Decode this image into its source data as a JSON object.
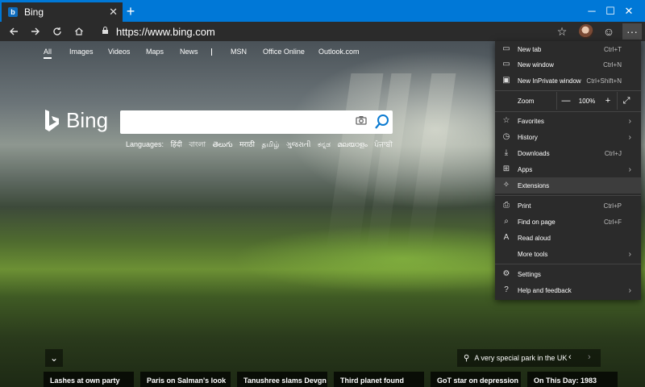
{
  "tab": {
    "title": "Bing",
    "favicon": "b"
  },
  "window": {
    "minimize": "─",
    "maximize": "☐",
    "close": "✕"
  },
  "address": {
    "url": "https://www.bing.com"
  },
  "bing": {
    "nav": [
      "All",
      "Images",
      "Videos",
      "Maps",
      "News",
      "MSN",
      "Office Online",
      "Outlook.com"
    ],
    "logo_text": "Bing",
    "search_placeholder": "",
    "languages_label": "Languages:",
    "languages": [
      "हिंदी",
      "বাংলা",
      "తెలుగు",
      "मराठी",
      "தமிழ்",
      "ગુજરાતી",
      "ಕನ್ನಡ",
      "മലയാളം",
      "ਪੰਜਾਬੀ"
    ]
  },
  "caption": {
    "text": "A very special park in the UK"
  },
  "news": [
    "Lashes at own party",
    "Paris on Salman's look",
    "Tanushree slams Devgn",
    "Third planet found",
    "GoT star on depression",
    "On This Day: 1983"
  ],
  "menu": {
    "new_tab": {
      "label": "New tab",
      "shortcut": "Ctrl+T"
    },
    "new_window": {
      "label": "New window",
      "shortcut": "Ctrl+N"
    },
    "inprivate": {
      "label": "New InPrivate window",
      "shortcut": "Ctrl+Shift+N"
    },
    "zoom": {
      "label": "Zoom",
      "minus": "—",
      "value": "100%",
      "plus": "+"
    },
    "favorites": {
      "label": "Favorites"
    },
    "history": {
      "label": "History"
    },
    "downloads": {
      "label": "Downloads",
      "shortcut": "Ctrl+J"
    },
    "apps": {
      "label": "Apps"
    },
    "extensions": {
      "label": "Extensions"
    },
    "print": {
      "label": "Print",
      "shortcut": "Ctrl+P"
    },
    "find": {
      "label": "Find on page",
      "shortcut": "Ctrl+F"
    },
    "read_aloud": {
      "label": "Read aloud"
    },
    "more_tools": {
      "label": "More tools"
    },
    "settings": {
      "label": "Settings"
    },
    "help": {
      "label": "Help and feedback"
    }
  }
}
